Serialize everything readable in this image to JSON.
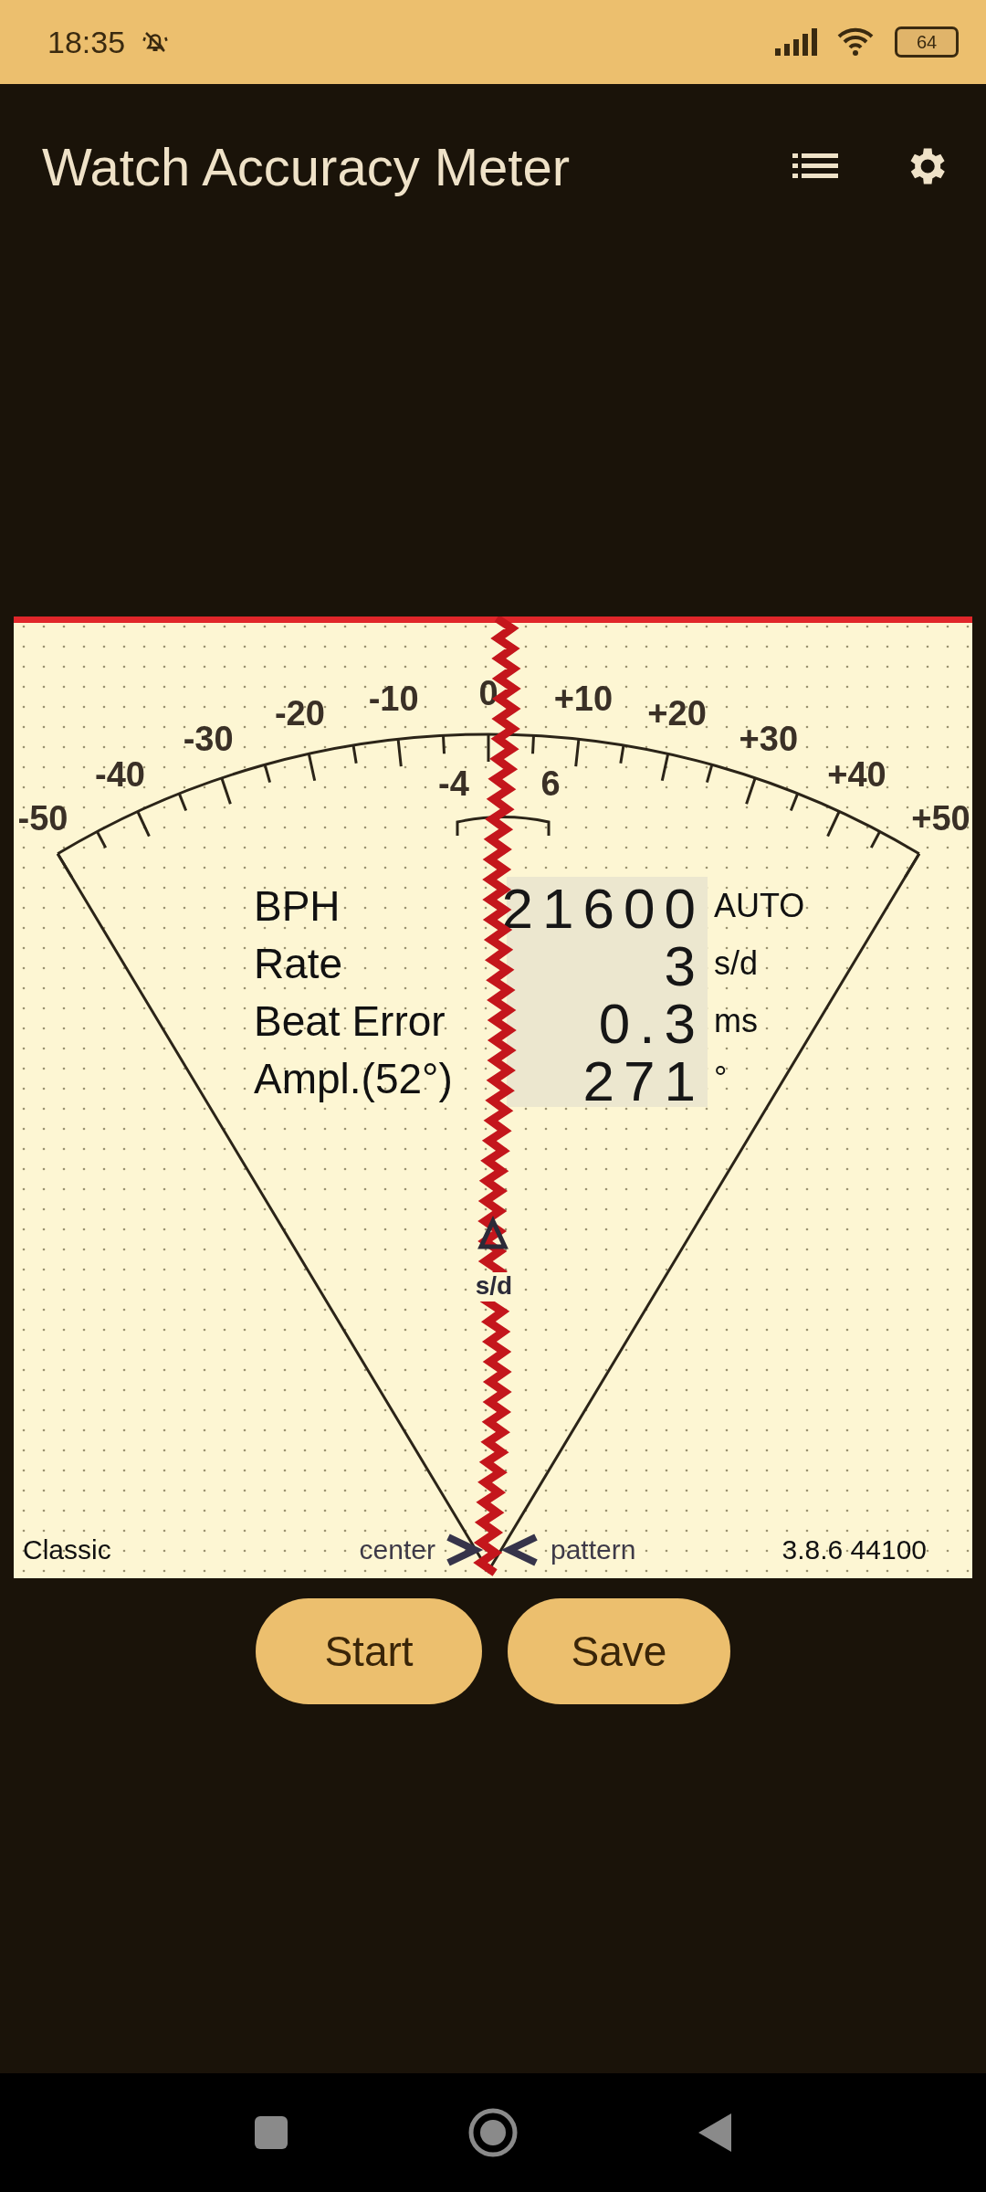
{
  "status_bar": {
    "time": "18:35",
    "battery": "64"
  },
  "app_bar": {
    "title": "Watch Accuracy Meter"
  },
  "dial": {
    "scale_labels": [
      "-50",
      "-40",
      "-30",
      "-20",
      "-10",
      "0",
      "+10",
      "+20",
      "+30",
      "+40",
      "+50"
    ],
    "inner_labels": [
      "-4",
      "6"
    ],
    "marker_label": "s/d",
    "readings": [
      {
        "label": "BPH",
        "value": "21600",
        "unit": "AUTO"
      },
      {
        "label": "Rate",
        "value": "3",
        "unit": "s/d"
      },
      {
        "label": "Beat Error",
        "value": "0.3",
        "unit": "ms"
      },
      {
        "label": "Ampl.(52°)",
        "value": "271",
        "unit": "°"
      }
    ],
    "mode": "Classic",
    "center_label": "center",
    "pattern_label": "pattern",
    "version": "3.8.6 44100"
  },
  "buttons": [
    "Start",
    "Save"
  ]
}
